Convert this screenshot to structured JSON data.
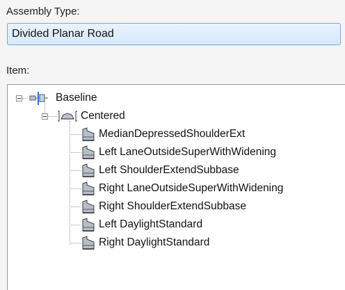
{
  "assembly": {
    "label": "Assembly Type:",
    "value": "Divided Planar Road"
  },
  "item": {
    "label": "Item:"
  },
  "tree": {
    "root": {
      "label": "Baseline",
      "icon": "baseline-icon"
    },
    "group": {
      "label": "Centered",
      "icon": "assembly-icon"
    },
    "children": [
      {
        "label": "MedianDepressedShoulderExt",
        "icon": "subassembly-icon"
      },
      {
        "label": "Left LaneOutsideSuperWithWidening",
        "icon": "subassembly-icon"
      },
      {
        "label": "Left ShoulderExtendSubbase",
        "icon": "subassembly-icon"
      },
      {
        "label": "Right LaneOutsideSuperWithWidening",
        "icon": "subassembly-icon"
      },
      {
        "label": "Right ShoulderExtendSubbase",
        "icon": "subassembly-icon"
      },
      {
        "label": "Left DaylightStandard",
        "icon": "subassembly-icon"
      },
      {
        "label": "Right DaylightStandard",
        "icon": "subassembly-icon"
      }
    ]
  }
}
